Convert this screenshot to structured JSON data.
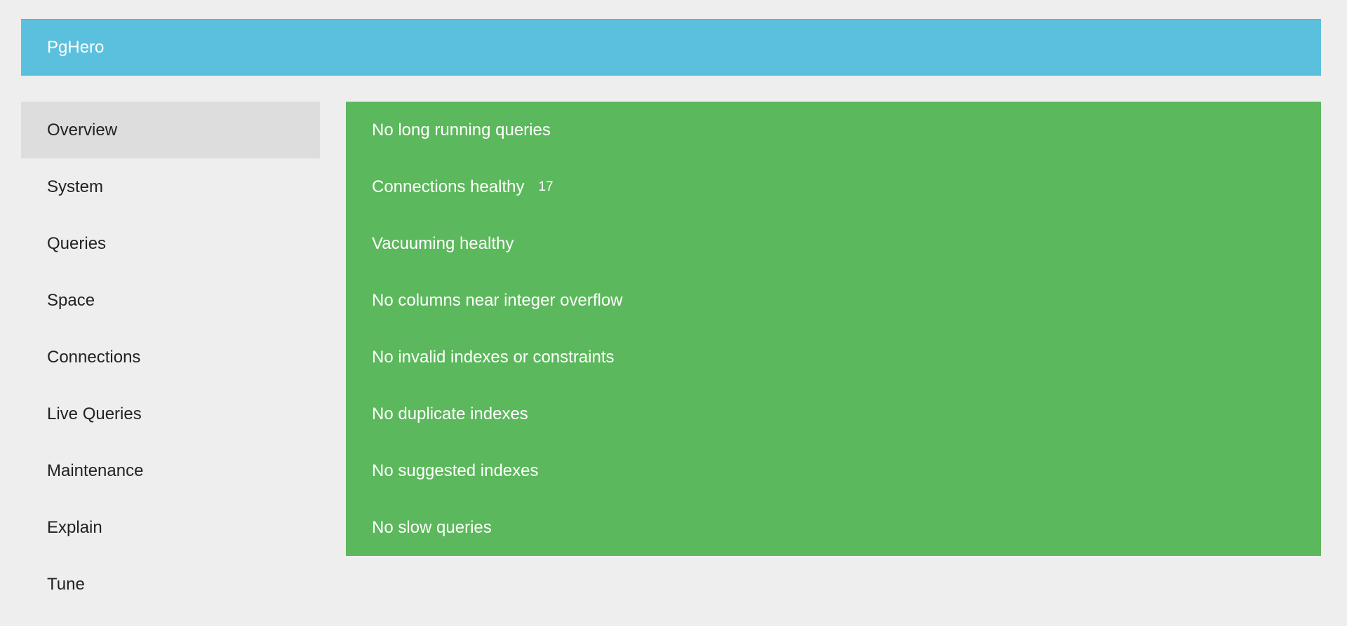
{
  "header": {
    "title": "PgHero"
  },
  "colors": {
    "background": "#eeeeee",
    "header": "#5bc0de",
    "success": "#5cb85c",
    "nav_active": "#dddddd"
  },
  "sidebar": {
    "items": [
      {
        "label": "Overview",
        "active": true
      },
      {
        "label": "System"
      },
      {
        "label": "Queries"
      },
      {
        "label": "Space"
      },
      {
        "label": "Connections"
      },
      {
        "label": "Live Queries"
      },
      {
        "label": "Maintenance"
      },
      {
        "label": "Explain"
      },
      {
        "label": "Tune"
      }
    ]
  },
  "checks": [
    {
      "label": "No long running queries"
    },
    {
      "label": "Connections healthy",
      "count": "17"
    },
    {
      "label": "Vacuuming healthy"
    },
    {
      "label": "No columns near integer overflow"
    },
    {
      "label": "No invalid indexes or constraints"
    },
    {
      "label": "No duplicate indexes"
    },
    {
      "label": "No suggested indexes"
    },
    {
      "label": "No slow queries"
    }
  ]
}
